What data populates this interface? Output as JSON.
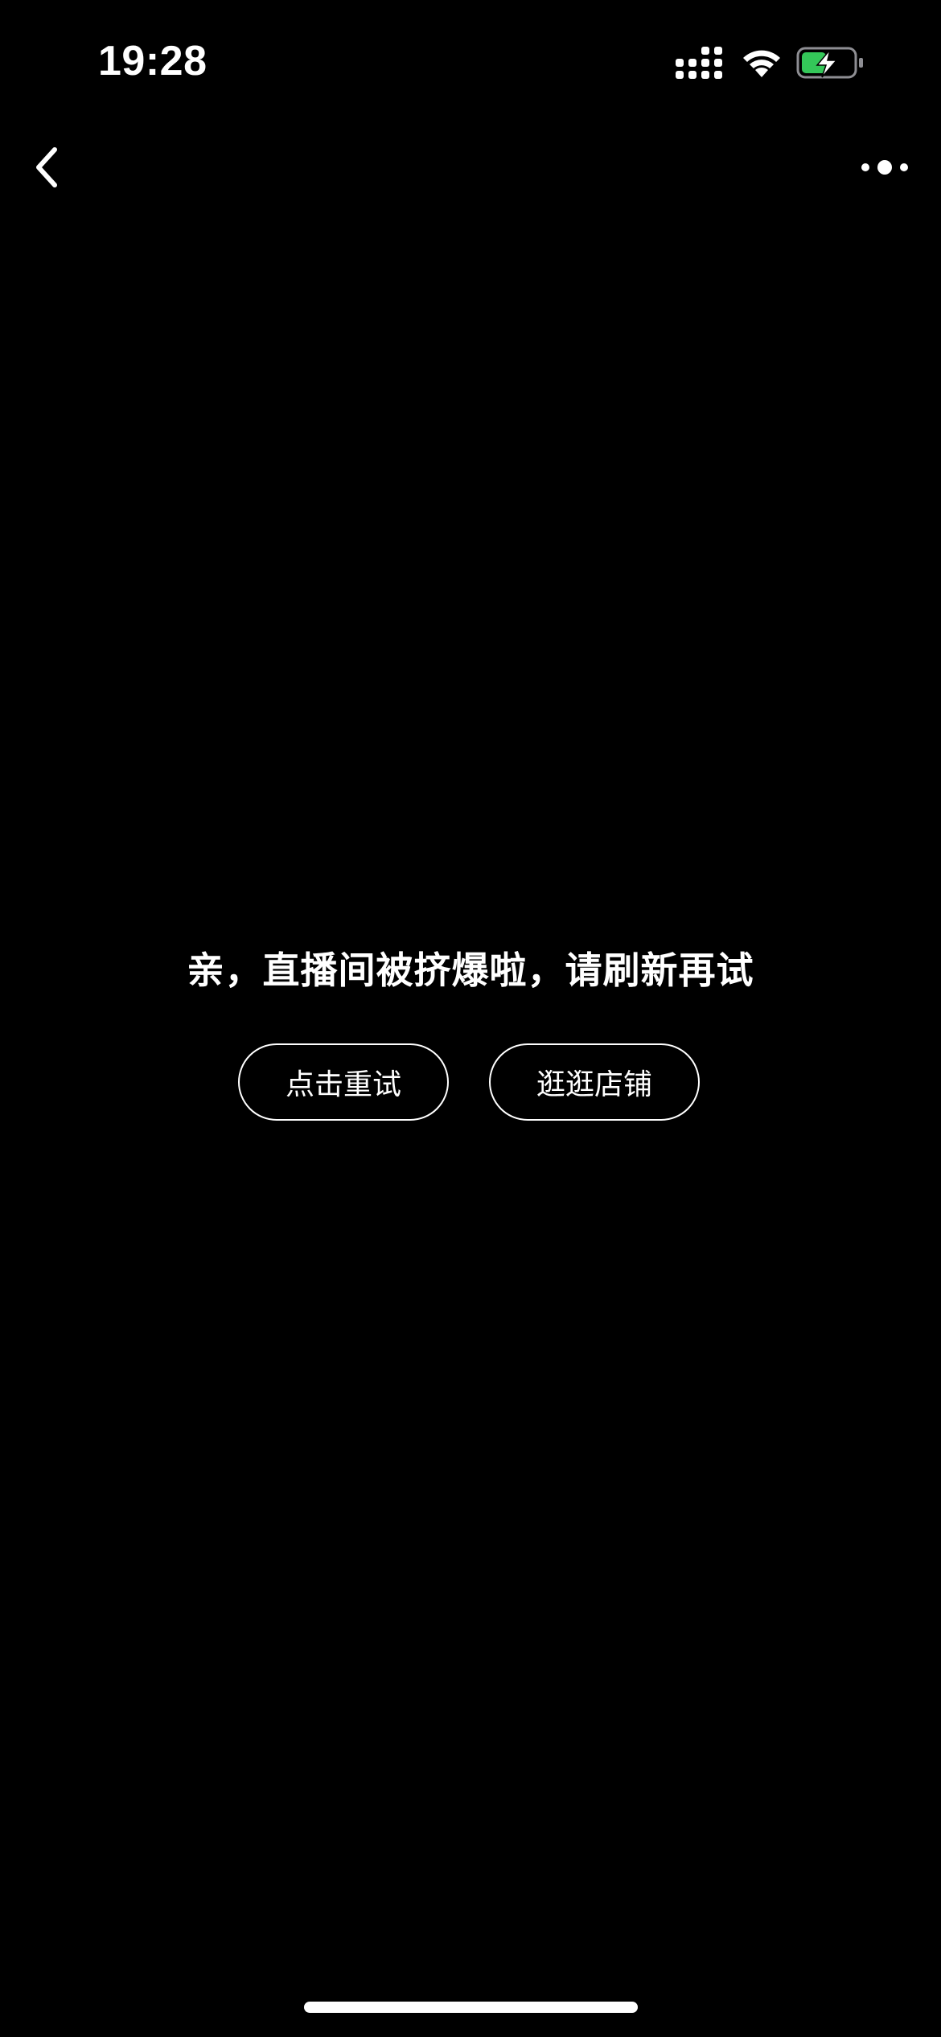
{
  "status_bar": {
    "time": "19:28",
    "icons": [
      "signal-icon",
      "wifi-icon",
      "battery-charging-icon"
    ],
    "battery_color": "#34C759"
  },
  "nav": {
    "back_icon": "chevron-left-icon",
    "more_icon": "more-dots-icon"
  },
  "message": {
    "text": "亲，直播间被挤爆啦，请刷新再试"
  },
  "actions": {
    "retry_label": "点击重试",
    "shop_label": "逛逛店铺"
  },
  "theme": {
    "background": "#000000",
    "foreground": "#FFFFFF"
  }
}
